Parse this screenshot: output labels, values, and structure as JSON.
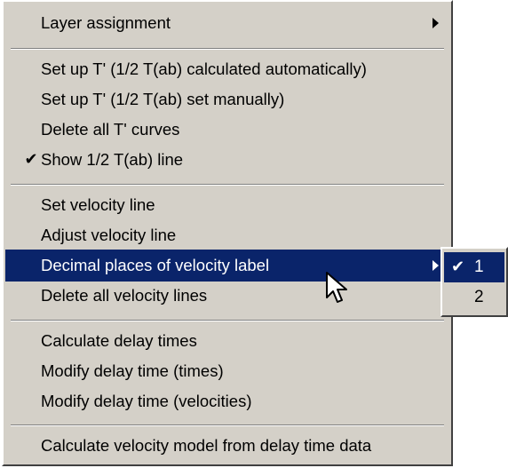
{
  "menu": {
    "items": [
      {
        "label": "Layer assignment",
        "has_submenu": true
      },
      {
        "label": "Set up T' (1/2 T(ab) calculated automatically)"
      },
      {
        "label": "Set up T' (1/2 T(ab) set manually)"
      },
      {
        "label": "Delete all T' curves"
      },
      {
        "label": "Show 1/2 T(ab) line",
        "checked": true,
        "check_glyph": "✔"
      },
      {
        "label": "Set velocity line"
      },
      {
        "label": "Adjust velocity line"
      },
      {
        "label": "Decimal places of velocity label",
        "has_submenu": true,
        "highlighted": true
      },
      {
        "label": "Delete all velocity lines"
      },
      {
        "label": "Calculate delay times"
      },
      {
        "label": "Modify delay time (times)"
      },
      {
        "label": "Modify delay time (velocities)"
      },
      {
        "label": "Calculate velocity model from delay time data"
      }
    ]
  },
  "submenu": {
    "items": [
      {
        "label": "1",
        "checked": true,
        "highlighted": true,
        "check_glyph": "✔"
      },
      {
        "label": "2"
      }
    ]
  },
  "colors": {
    "menu_bg": "#d4d0c8",
    "highlight_bg": "#0a246a",
    "highlight_text": "#ffffff"
  },
  "icons": {
    "pointer": "mouse-pointer-icon",
    "submenu_arrow": "triangle-right-icon",
    "check": "check-icon"
  }
}
